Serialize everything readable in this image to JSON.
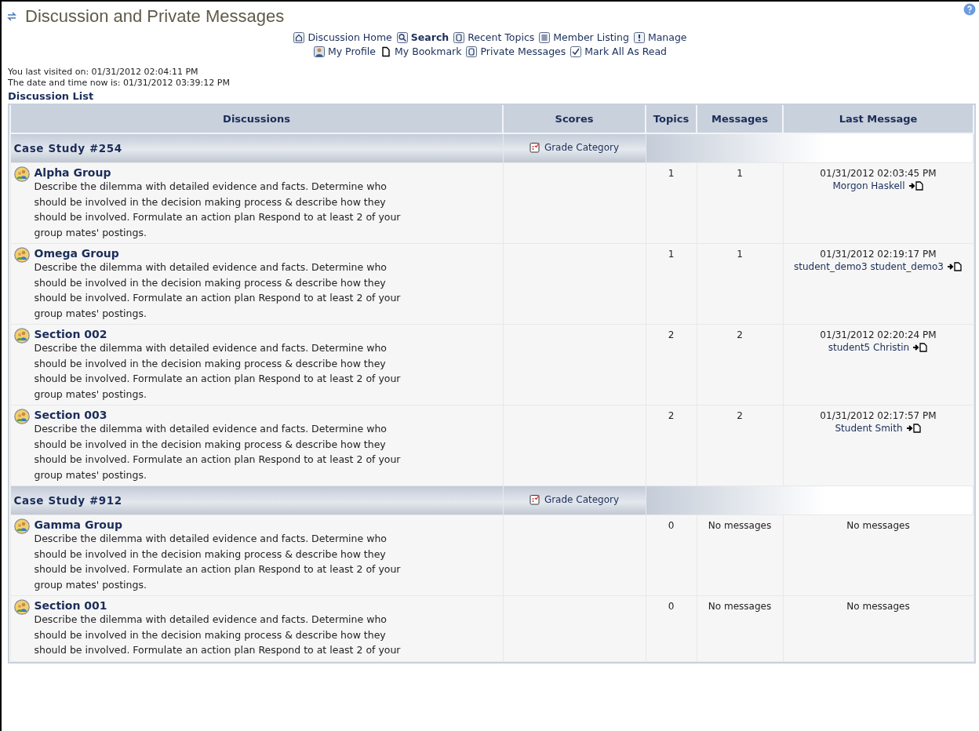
{
  "header": {
    "title": "Discussion and Private Messages"
  },
  "nav": [
    [
      {
        "label": "Discussion Home",
        "selected": false
      },
      {
        "label": "Search",
        "selected": true
      },
      {
        "label": "Recent Topics",
        "selected": false
      },
      {
        "label": "Member Listing",
        "selected": false
      },
      {
        "label": "Manage",
        "selected": false
      }
    ],
    [
      {
        "label": "My Profile",
        "selected": false
      },
      {
        "label": "My Bookmark",
        "selected": false
      },
      {
        "label": "Private Messages",
        "selected": false
      },
      {
        "label": "Mark All As Read",
        "selected": false
      }
    ]
  ],
  "visits": [
    "You last visited on: 01/31/2012 02:04:11 PM",
    "The date and time now is: 01/31/2012 03:39:12 PM"
  ],
  "list_title": "Discussion List",
  "columns": [
    "Discussions",
    "Scores",
    "Topics",
    "Messages",
    "Last Message"
  ],
  "groups": [
    {
      "title": "Case Study #254",
      "scores": "Grade Category",
      "forums": [
        {
          "title": "Alpha Group",
          "description": [
            "Describe the dilemma with detailed evidence and facts. Determine who",
            "should be involved in the decision making process & describe how they",
            "should be involved. Formulate an action plan Respond to at least 2 of your",
            "group mates' postings."
          ],
          "topics": "1",
          "messages": "1",
          "last_message": {
            "time": "01/31/2012 02:03:45 PM",
            "author": "Morgon Haskell"
          }
        },
        {
          "title": "Omega Group",
          "description": [
            "Describe the dilemma with detailed evidence and facts. Determine who",
            "should be involved in the decision making process & describe how they",
            "should be involved. Formulate an action plan Respond to at least 2 of your",
            "group mates' postings."
          ],
          "topics": "1",
          "messages": "1",
          "last_message": {
            "time": "01/31/2012 02:19:17 PM",
            "author": "student_demo3 student_demo3"
          }
        },
        {
          "title": "Section 002",
          "description": [
            "Describe the dilemma with detailed evidence and facts. Determine who",
            "should be involved in the decision making process & describe how they",
            "should be involved. Formulate an action plan Respond to at least 2 of your",
            "group mates' postings."
          ],
          "topics": "2",
          "messages": "2",
          "last_message": {
            "time": "01/31/2012 02:20:24 PM",
            "author": "student5 Christin"
          }
        },
        {
          "title": "Section 003",
          "description": [
            "Describe the dilemma with detailed evidence and facts. Determine who",
            "should be involved in the decision making process & describe how they",
            "should be involved. Formulate an action plan Respond to at least 2 of your",
            "group mates' postings."
          ],
          "topics": "2",
          "messages": "2",
          "last_message": {
            "time": "01/31/2012 02:17:57 PM",
            "author": "Student Smith"
          }
        }
      ]
    },
    {
      "title": "Case Study #912",
      "scores": "Grade Category",
      "forums": [
        {
          "title": "Gamma Group",
          "description": [
            "Describe the dilemma with detailed evidence and facts. Determine who",
            "should be involved in the decision making process & describe how they",
            "should be involved. Formulate an action plan Respond to at least 2 of your",
            "group mates' postings."
          ],
          "topics": "0",
          "messages": "No messages",
          "last_message_note": "No messages"
        },
        {
          "title": "Section 001",
          "description": [
            "Describe the dilemma with detailed evidence and facts. Determine who",
            "should be involved in the decision making process & describe how they",
            "should be involved. Formulate an action plan Respond to at least 2 of your"
          ],
          "topics": "0",
          "messages": "No messages",
          "last_message_note": "No messages"
        }
      ]
    }
  ]
}
